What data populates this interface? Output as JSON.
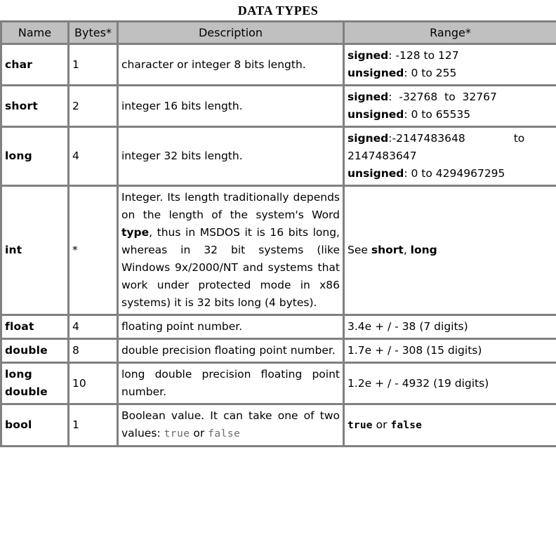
{
  "title": "DATA TYPES",
  "table": {
    "headers": [
      {
        "key": "name",
        "label": "Name"
      },
      {
        "key": "bytes",
        "label": "Bytes*"
      },
      {
        "key": "desc",
        "label": "Description"
      },
      {
        "key": "range",
        "label": "Range*"
      }
    ],
    "rows": [
      {
        "name": "char",
        "bytes": "1",
        "description": "character or integer 8 bits length.",
        "range": {
          "signed_label": "signed",
          "signed_value": ": -128 to 127",
          "unsigned_label": "unsigned",
          "unsigned_value": ": 0 to 255"
        }
      },
      {
        "name": "short",
        "bytes": "2",
        "description": "integer 16 bits length.",
        "range": {
          "signed_label": "signed",
          "signed_value": ":  -32768  to  32767",
          "unsigned_label": "unsigned",
          "unsigned_value": ": 0 to 65535"
        }
      },
      {
        "name": "long",
        "bytes": "4",
        "description": "integer 32 bits length.",
        "range": {
          "signed_label": "signed",
          "signed_value": ":-2147483648              to 2147483647",
          "unsigned_label": "unsigned",
          "unsigned_value": ": 0 to 4294967295"
        }
      },
      {
        "name": "int",
        "bytes": "*",
        "description_part1": "Integer. Its length traditionally depends on the length of the system's Word ",
        "description_bold1": "type",
        "description_part2": ", thus in MSDOS it is 16 bits long, whereas in 32 bit systems (like Windows 9x/2000/NT and systems that work under protected mode in x86 systems) it is 32 bits long (4 bytes).",
        "range": {
          "see_label": "See ",
          "see_ref1": "short",
          "see_sep": ", ",
          "see_ref2": "long"
        }
      },
      {
        "name": "float",
        "bytes": "4",
        "description": "floating point number.",
        "range_plain": "3.4e + / - 38 (7 digits)"
      },
      {
        "name": "double",
        "bytes": "8",
        "description": "double precision floating point number.",
        "range_plain": "1.7e + / - 308 (15 digits)"
      },
      {
        "name": "long double",
        "name_line1": "long",
        "name_line2": "double",
        "bytes": "10",
        "description": "long double precision floating point number.",
        "range_plain": "1.2e + / - 4932 (19 digits)"
      },
      {
        "name": "bool",
        "bytes": "1",
        "description_part1": "Boolean value. It can take one of two values: ",
        "description_mono1": "true",
        "description_part2": " or ",
        "description_mono2": "false",
        "range": {
          "true_label": "true",
          "or_label": " or ",
          "false_label": "false"
        }
      }
    ]
  },
  "colors": {
    "header_background": "#c0c0c0",
    "border": "#808080",
    "text": "#000000",
    "mono_text": "#6a6a6a",
    "page_background": "#ffffff"
  }
}
